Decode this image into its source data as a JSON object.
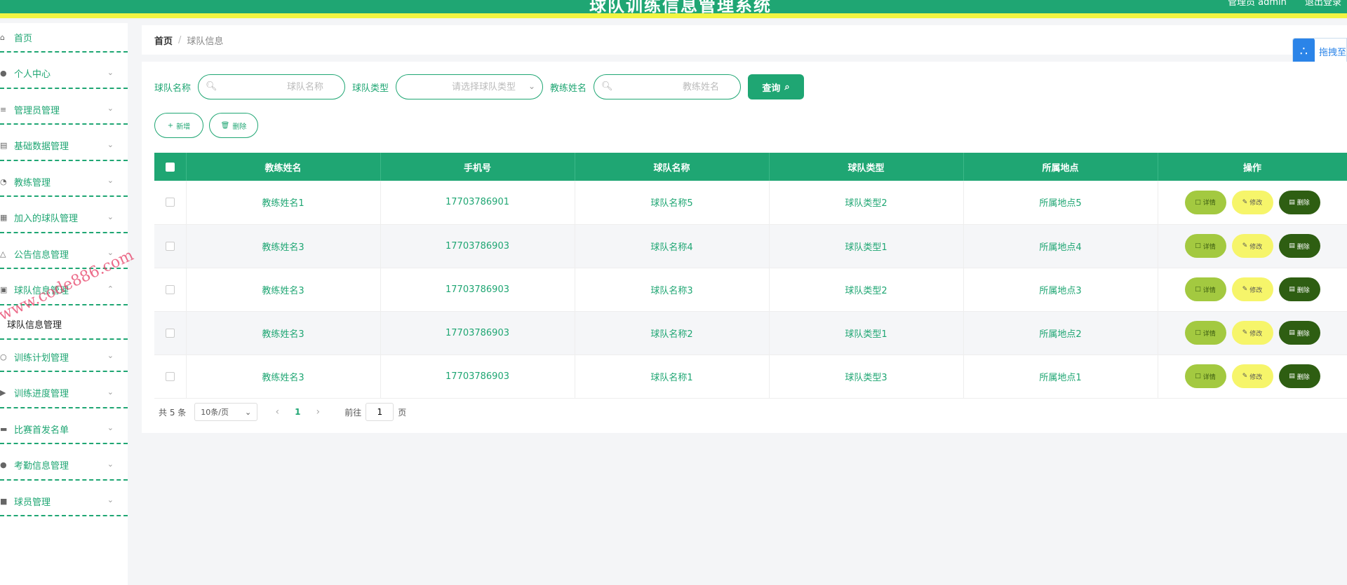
{
  "header": {
    "title": "球队训练信息管理系统",
    "user": "管理员 admin",
    "logout": "退出登录"
  },
  "sidebar": {
    "items": [
      {
        "label": "首页",
        "icon": "home-icon"
      },
      {
        "label": "个人中心",
        "icon": "user-icon"
      },
      {
        "label": "管理员管理",
        "icon": "sliders-icon"
      },
      {
        "label": "基础数据管理",
        "icon": "clipboard-icon"
      },
      {
        "label": "教练管理",
        "icon": "compass-icon"
      },
      {
        "label": "加入的球队管理",
        "icon": "grid-icon"
      },
      {
        "label": "公告信息管理",
        "icon": "bell-icon"
      },
      {
        "label": "球队信息管理",
        "icon": "doc-icon"
      },
      {
        "label": "训练计划管理",
        "icon": "mic-icon"
      },
      {
        "label": "训练进度管理",
        "icon": "send-icon"
      },
      {
        "label": "比赛首发名单",
        "icon": "folder-icon"
      },
      {
        "label": "考勤信息管理",
        "icon": "user-icon"
      },
      {
        "label": "球员管理",
        "icon": "camera-icon"
      }
    ],
    "submenu": "球队信息管理"
  },
  "watermark": "www.code886.com",
  "breadcrumb": {
    "home": "首页",
    "sep": "/",
    "current": "球队信息"
  },
  "drag_widget": {
    "label": "拖拽至"
  },
  "search": {
    "team_name_label": "球队名称",
    "team_name_placeholder": "球队名称",
    "team_type_label": "球队类型",
    "team_type_placeholder": "请选择球队类型",
    "coach_label": "教练姓名",
    "coach_placeholder": "教练姓名",
    "query": "查询"
  },
  "actions": {
    "add": "新增",
    "delete": "删除"
  },
  "table": {
    "headers": [
      "教练姓名",
      "手机号",
      "球队名称",
      "球队类型",
      "所属地点",
      "操作"
    ],
    "rows": [
      [
        "教练姓名1",
        "17703786901",
        "球队名称5",
        "球队类型2",
        "所属地点5"
      ],
      [
        "教练姓名3",
        "17703786903",
        "球队名称4",
        "球队类型1",
        "所属地点4"
      ],
      [
        "教练姓名3",
        "17703786903",
        "球队名称3",
        "球队类型2",
        "所属地点3"
      ],
      [
        "教练姓名3",
        "17703786903",
        "球队名称2",
        "球队类型1",
        "所属地点2"
      ],
      [
        "教练姓名3",
        "17703786903",
        "球队名称1",
        "球队类型3",
        "所属地点1"
      ]
    ],
    "op_detail": "详情",
    "op_edit": "修改",
    "op_delete": "删除"
  },
  "pager": {
    "total": "共 5 条",
    "size": "10条/页",
    "current": "1",
    "goto": "前往",
    "goto_value": "1",
    "page_suffix": "页"
  }
}
